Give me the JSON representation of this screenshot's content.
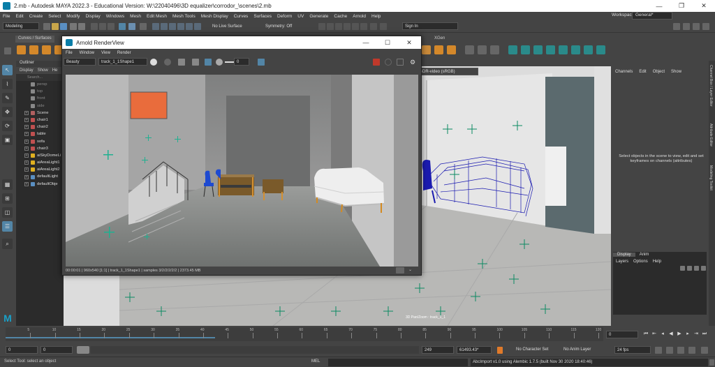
{
  "window": {
    "title": "2.mb - Autodesk MAYA 2022.3 - Educational Version: W:\\22040496\\3D equalizer\\corrodor_\\scenes\\2.mb",
    "min": "—",
    "restore": "❐",
    "close": "✕"
  },
  "menu": [
    "File",
    "Edit",
    "Create",
    "Select",
    "Modify",
    "Display",
    "Windows",
    "Mesh",
    "Edit Mesh",
    "Mesh Tools",
    "Mesh Display",
    "Curves",
    "Surfaces",
    "Deform",
    "UV",
    "Generate",
    "Cache",
    "Arnold",
    "Help"
  ],
  "workspace": {
    "label": "Workspace:",
    "value": "General*"
  },
  "toolbar": {
    "mode": "Modeling",
    "live_surface": "No Live Surface",
    "symmetry": "Symmetry: Off",
    "sign_in": "Sign In"
  },
  "shelf": {
    "tab_left": "Curves / Surfaces",
    "tab_right": "XGen"
  },
  "outliner": {
    "title": "Outliner",
    "menu": [
      "Display",
      "Show",
      "He"
    ],
    "search_placeholder": "Search...",
    "items": [
      {
        "label": "persp",
        "dim": true
      },
      {
        "label": "top",
        "dim": true
      },
      {
        "label": "front",
        "dim": true
      },
      {
        "label": "side",
        "dim": true
      },
      {
        "label": "Scene",
        "dim": false
      },
      {
        "label": "chair1",
        "dim": false
      },
      {
        "label": "chair2",
        "dim": false
      },
      {
        "label": "table",
        "dim": false
      },
      {
        "label": "sofa",
        "dim": false
      },
      {
        "label": "chair3",
        "dim": false
      },
      {
        "label": "aiSkyDomeLi",
        "dim": false
      },
      {
        "label": "aiAreaLight1",
        "dim": false
      },
      {
        "label": "aiAreaLight2",
        "dim": false
      },
      {
        "label": "defaultLight",
        "dim": false
      },
      {
        "label": "defaultObje",
        "dim": false
      }
    ]
  },
  "viewport": {
    "color_space": "SDR-video (sRGB)",
    "hud_label": "3D Pan/Zoom : track_1_1"
  },
  "renderview": {
    "title": "Arnold RenderView",
    "menu": [
      "File",
      "Window",
      "View",
      "Render"
    ],
    "aov": "Beauty",
    "camera": "track_1_1Shape1",
    "exposure": "0",
    "status": "00:00:01 | 960x540 [1:1] | track_1_1Shape1 | samples 3/2/2/2/2/2 | 2373.45 MB"
  },
  "channelbox": {
    "menu": [
      "Channels",
      "Edit",
      "Object",
      "Show"
    ],
    "message": "Select objects in the scene to view, edit and set keyframes on channels (attributes)",
    "layer_tabs": [
      "Display",
      "Anim"
    ],
    "layer_menu": [
      "Layers",
      "Options",
      "Help"
    ]
  },
  "sidetabs": [
    "Channel Box / Layer Editor",
    "Attribute Editor",
    "Modeling Toolkit"
  ],
  "timeline": {
    "ticks": [
      "5",
      "10",
      "15",
      "20",
      "25",
      "30",
      "35",
      "40",
      "45",
      "50",
      "55",
      "60",
      "65",
      "70",
      "75",
      "80",
      "85",
      "90",
      "95",
      "100",
      "105",
      "110",
      "115",
      "120"
    ],
    "current": "0"
  },
  "range": {
    "start": "0",
    "start2": "0",
    "end": "249",
    "end2": "61493.43*",
    "character_set": "No Character Set",
    "anim_layer": "No Anim Layer",
    "fps": "24 fps"
  },
  "status": {
    "help": "Select Tool: select an object",
    "lang": "MEL",
    "message": "AbcImport v1.0 using Alembic 1.7.5 (built Nov 30 2020 18:40:46)"
  },
  "colors": {
    "accent": "#5285a6",
    "bg": "#444444",
    "panel": "#2b2b2b",
    "render_stop": "#c0392b"
  }
}
